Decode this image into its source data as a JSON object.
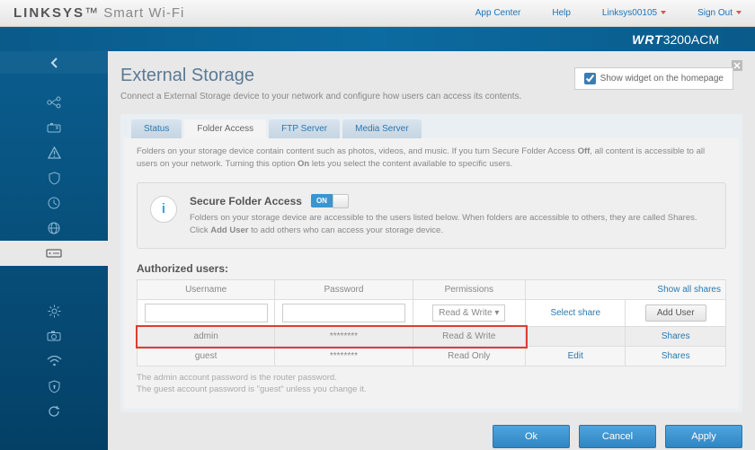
{
  "topbar": {
    "brand_bold": "LINKSYS",
    "brand_light": "Smart Wi-Fi",
    "nav": {
      "app_center": "App Center",
      "help": "Help",
      "account": "Linksys00105",
      "signout": "Sign Out"
    }
  },
  "header": {
    "model_prefix": "WRT",
    "model_num": "3200ACM"
  },
  "page": {
    "title": "External Storage",
    "desc": "Connect a External Storage device to your network and configure how users can access its contents.",
    "widget_label": "Show widget on the homepage"
  },
  "tabs": {
    "status": "Status",
    "folder": "Folder Access",
    "ftp": "FTP Server",
    "media": "Media Server"
  },
  "folder_tab": {
    "desc_part1": "Folders on your storage device contain content such as photos, videos, and music. If you turn Secure Folder Access ",
    "desc_off": "Off",
    "desc_part2": ", all content is accessible to all users on your network. Turning this option ",
    "desc_on": "On",
    "desc_part3": " lets you select the content available to specific users.",
    "secure": {
      "title": "Secure Folder Access",
      "toggle": "ON",
      "desc_part1": "Folders on your storage device are accessible to the users listed below. When folders are accessible to others, they are called Shares. Click ",
      "desc_add": "Add User",
      "desc_part2": " to add others who can access your storage device."
    }
  },
  "users": {
    "section_title": "Authorized users:",
    "cols": {
      "username": "Username",
      "password": "Password",
      "permissions": "Permissions"
    },
    "show_all": "Show all shares",
    "new_perm": "Read & Write",
    "select_share": "Select share",
    "add_user": "Add User",
    "rows": [
      {
        "username": "admin",
        "password": "********",
        "perm": "Read & Write",
        "edit": "",
        "shares": "Shares"
      },
      {
        "username": "guest",
        "password": "********",
        "perm": "Read Only",
        "edit": "Edit",
        "shares": "Shares"
      }
    ],
    "note1": "The admin account password is the router password.",
    "note2": "The guest account password is \"guest\" unless you change it."
  },
  "buttons": {
    "ok": "Ok",
    "cancel": "Cancel",
    "apply": "Apply"
  }
}
